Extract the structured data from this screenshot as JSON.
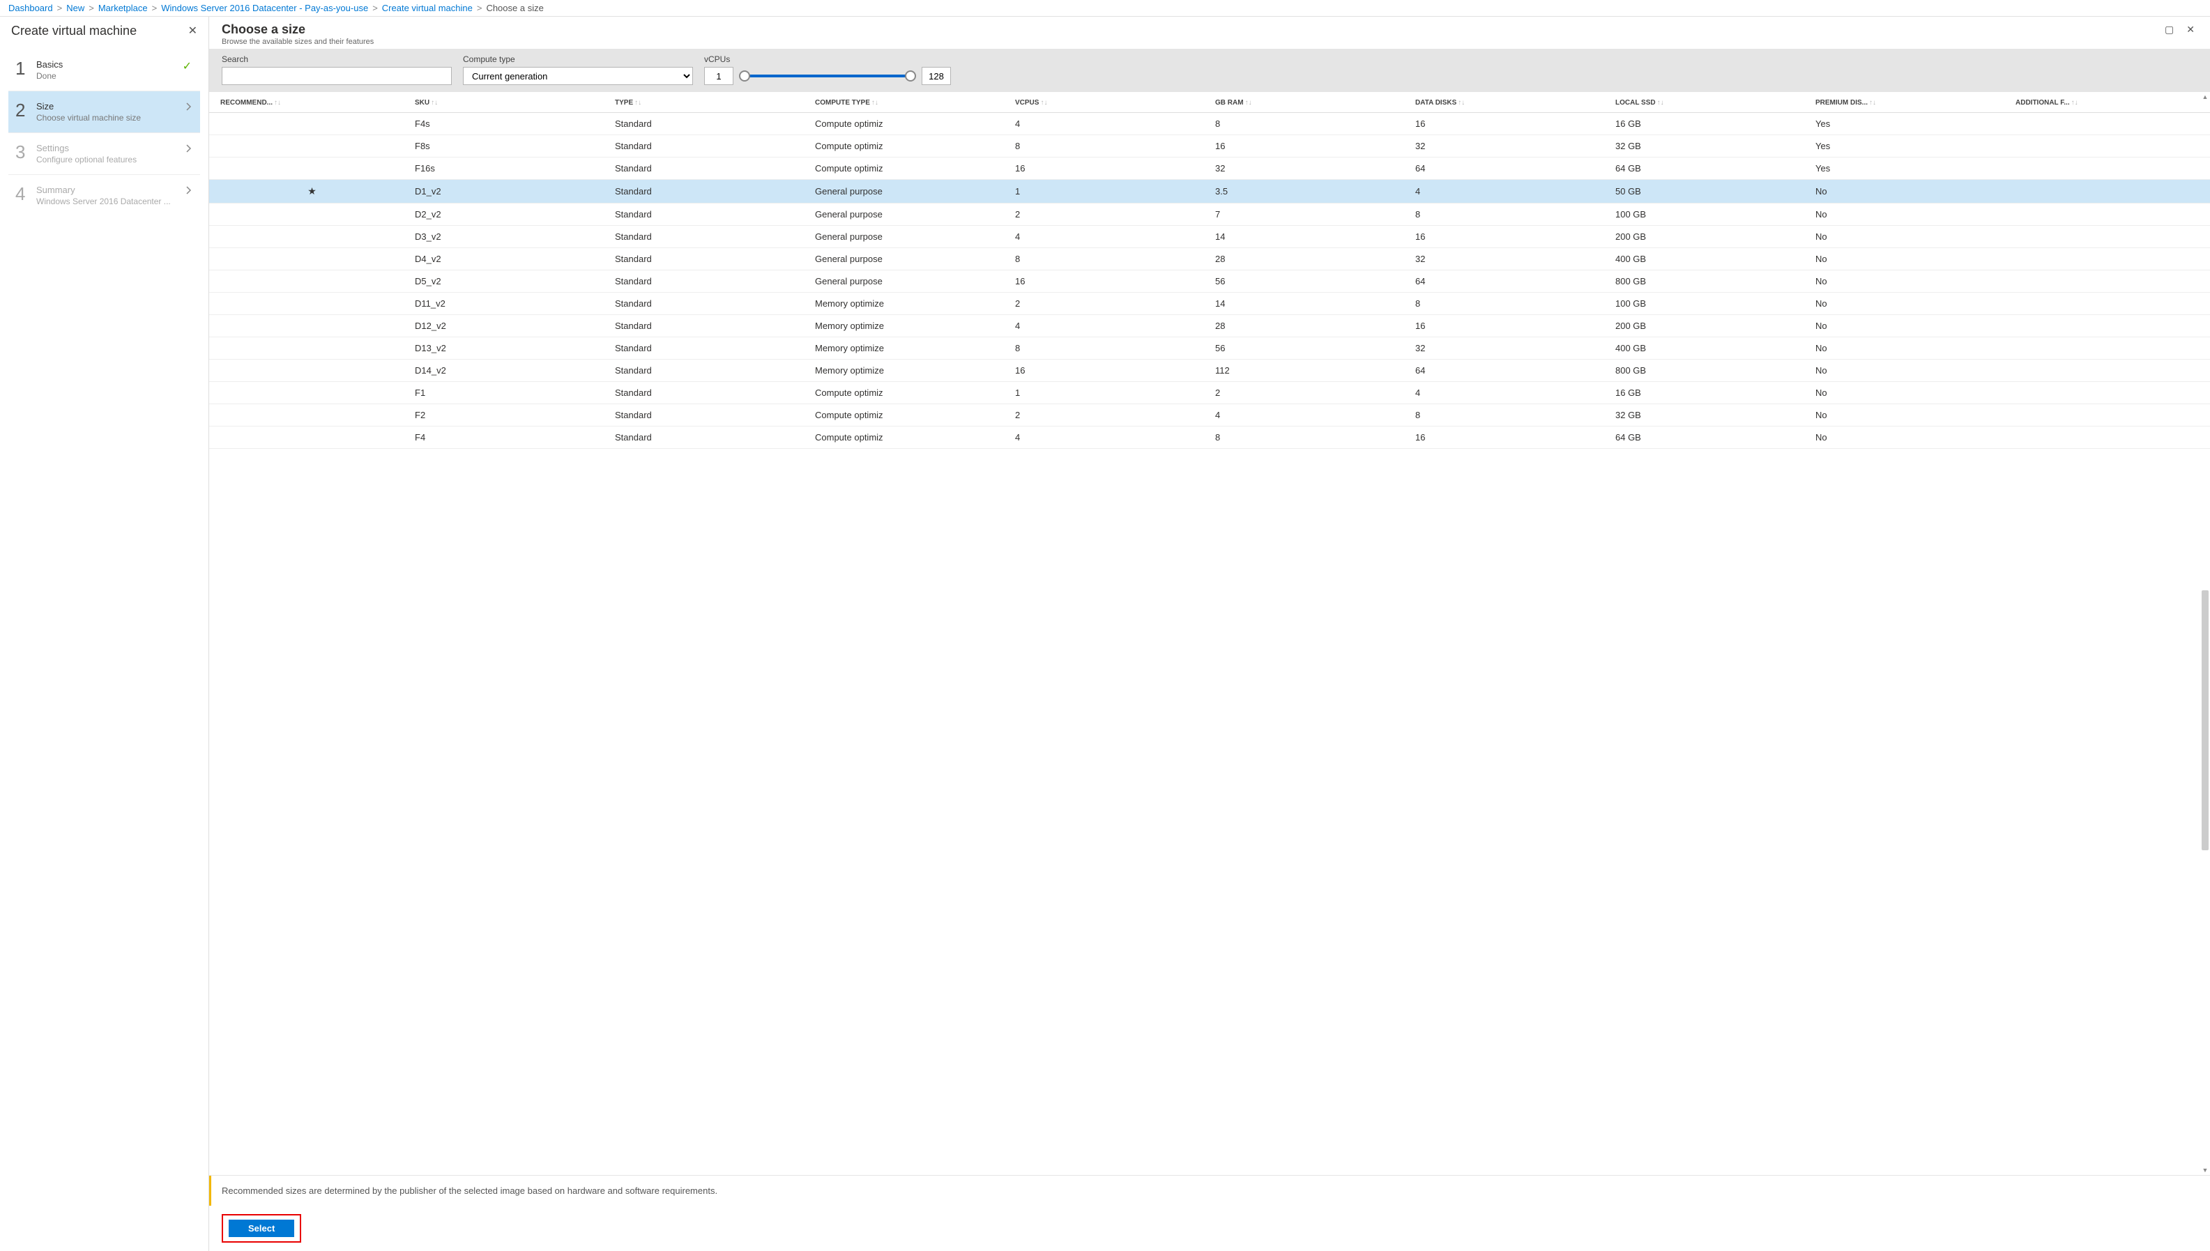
{
  "breadcrumb": {
    "items": [
      "Dashboard",
      "New",
      "Marketplace",
      "Windows Server 2016 Datacenter - Pay-as-you-use",
      "Create virtual machine"
    ],
    "current": "Choose a size"
  },
  "leftPanel": {
    "title": "Create virtual machine",
    "steps": [
      {
        "num": "1",
        "title": "Basics",
        "sub": "Done",
        "state": "done"
      },
      {
        "num": "2",
        "title": "Size",
        "sub": "Choose virtual machine size",
        "state": "active"
      },
      {
        "num": "3",
        "title": "Settings",
        "sub": "Configure optional features",
        "state": "dim"
      },
      {
        "num": "4",
        "title": "Summary",
        "sub": "Windows Server 2016 Datacenter ...",
        "state": "dim"
      }
    ]
  },
  "rightPanel": {
    "title": "Choose a size",
    "subtitle": "Browse the available sizes and their features"
  },
  "filter": {
    "searchLabel": "Search",
    "searchValue": "",
    "computeLabel": "Compute type",
    "computeValue": "Current generation",
    "vcpuLabel": "vCPUs",
    "vcpuMin": "1",
    "vcpuMax": "128"
  },
  "columns": [
    "RECOMMEND...",
    "SKU",
    "TYPE",
    "COMPUTE TYPE",
    "VCPUS",
    "GB RAM",
    "DATA DISKS",
    "LOCAL SSD",
    "PREMIUM DIS...",
    "ADDITIONAL F..."
  ],
  "rows": [
    {
      "rec": "",
      "sku": "F4s",
      "type": "Standard",
      "ct": "Compute optimiz",
      "vcpu": "4",
      "ram": "8",
      "dd": "16",
      "ssd": "16 GB",
      "prem": "Yes",
      "add": ""
    },
    {
      "rec": "",
      "sku": "F8s",
      "type": "Standard",
      "ct": "Compute optimiz",
      "vcpu": "8",
      "ram": "16",
      "dd": "32",
      "ssd": "32 GB",
      "prem": "Yes",
      "add": ""
    },
    {
      "rec": "",
      "sku": "F16s",
      "type": "Standard",
      "ct": "Compute optimiz",
      "vcpu": "16",
      "ram": "32",
      "dd": "64",
      "ssd": "64 GB",
      "prem": "Yes",
      "add": ""
    },
    {
      "rec": "★",
      "sku": "D1_v2",
      "type": "Standard",
      "ct": "General purpose",
      "vcpu": "1",
      "ram": "3.5",
      "dd": "4",
      "ssd": "50 GB",
      "prem": "No",
      "add": "",
      "selected": true
    },
    {
      "rec": "",
      "sku": "D2_v2",
      "type": "Standard",
      "ct": "General purpose",
      "vcpu": "2",
      "ram": "7",
      "dd": "8",
      "ssd": "100 GB",
      "prem": "No",
      "add": ""
    },
    {
      "rec": "",
      "sku": "D3_v2",
      "type": "Standard",
      "ct": "General purpose",
      "vcpu": "4",
      "ram": "14",
      "dd": "16",
      "ssd": "200 GB",
      "prem": "No",
      "add": ""
    },
    {
      "rec": "",
      "sku": "D4_v2",
      "type": "Standard",
      "ct": "General purpose",
      "vcpu": "8",
      "ram": "28",
      "dd": "32",
      "ssd": "400 GB",
      "prem": "No",
      "add": ""
    },
    {
      "rec": "",
      "sku": "D5_v2",
      "type": "Standard",
      "ct": "General purpose",
      "vcpu": "16",
      "ram": "56",
      "dd": "64",
      "ssd": "800 GB",
      "prem": "No",
      "add": ""
    },
    {
      "rec": "",
      "sku": "D11_v2",
      "type": "Standard",
      "ct": "Memory optimize",
      "vcpu": "2",
      "ram": "14",
      "dd": "8",
      "ssd": "100 GB",
      "prem": "No",
      "add": ""
    },
    {
      "rec": "",
      "sku": "D12_v2",
      "type": "Standard",
      "ct": "Memory optimize",
      "vcpu": "4",
      "ram": "28",
      "dd": "16",
      "ssd": "200 GB",
      "prem": "No",
      "add": ""
    },
    {
      "rec": "",
      "sku": "D13_v2",
      "type": "Standard",
      "ct": "Memory optimize",
      "vcpu": "8",
      "ram": "56",
      "dd": "32",
      "ssd": "400 GB",
      "prem": "No",
      "add": ""
    },
    {
      "rec": "",
      "sku": "D14_v2",
      "type": "Standard",
      "ct": "Memory optimize",
      "vcpu": "16",
      "ram": "112",
      "dd": "64",
      "ssd": "800 GB",
      "prem": "No",
      "add": ""
    },
    {
      "rec": "",
      "sku": "F1",
      "type": "Standard",
      "ct": "Compute optimiz",
      "vcpu": "1",
      "ram": "2",
      "dd": "4",
      "ssd": "16 GB",
      "prem": "No",
      "add": ""
    },
    {
      "rec": "",
      "sku": "F2",
      "type": "Standard",
      "ct": "Compute optimiz",
      "vcpu": "2",
      "ram": "4",
      "dd": "8",
      "ssd": "32 GB",
      "prem": "No",
      "add": ""
    },
    {
      "rec": "",
      "sku": "F4",
      "type": "Standard",
      "ct": "Compute optimiz",
      "vcpu": "4",
      "ram": "8",
      "dd": "16",
      "ssd": "64 GB",
      "prem": "No",
      "add": ""
    }
  ],
  "infoText": "Recommended sizes are determined by the publisher of the selected image based on hardware and software requirements.",
  "selectLabel": "Select"
}
